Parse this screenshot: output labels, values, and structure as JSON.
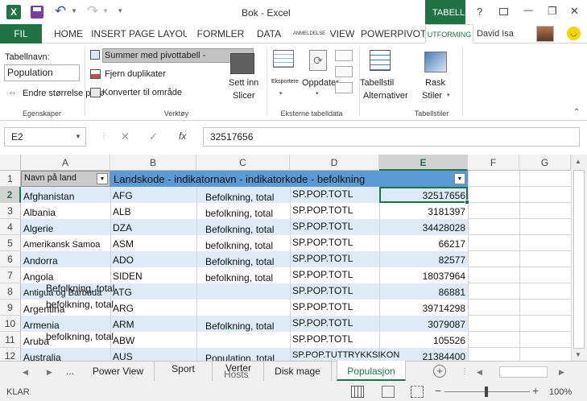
{
  "window": {
    "title": "Bok - Excel",
    "context_tab": "TABELL..."
  },
  "quick_access": {
    "save": "save-icon",
    "undo": "undo-icon",
    "redo": "redo-icon"
  },
  "title_controls": {
    "help": "?",
    "minimize": "—",
    "restore": "❐",
    "close": "✕"
  },
  "ribbon_tabs": [
    "FIL",
    "HOME",
    "INSERT",
    "PAGE LAYOU",
    "FORMLER",
    "DATA",
    "ANMELDELSE",
    "VIEW",
    "POWERPIVOT",
    "UTFORMING"
  ],
  "user": {
    "name": "David Isa"
  },
  "ribbon": {
    "egenskaper": {
      "label": "Tabellnavn:",
      "value": "Population",
      "resize": "Endre størrelse på ta",
      "group": "Egenskaper"
    },
    "verktoy": {
      "pivot": "Summer med pivottabell -",
      "remove_dup": "Fjern duplikater",
      "convert": "Konverter til område",
      "slicer_line1": "Sett inn",
      "slicer_line2": "Slicer",
      "group": "Verktøy"
    },
    "eksterne": {
      "export": "Eksportere",
      "refresh": "Oppdater",
      "group": "Eksterne tabelldata"
    },
    "tabellstil": {
      "options_line1": "Tabellstil",
      "options_line2": "Alternativer",
      "quick_line1": "Rask",
      "quick_line2": "Stiler",
      "group": "Tabellstiler"
    }
  },
  "formula_bar": {
    "name_box": "E2",
    "fx": "fx",
    "value": "32517656"
  },
  "columns": [
    "A",
    "B",
    "C",
    "D",
    "E",
    "F",
    "G"
  ],
  "rows": [
    "1",
    "2",
    "3",
    "4",
    "5",
    "6",
    "7",
    "8",
    "9",
    "10",
    "11",
    "12"
  ],
  "header_row": {
    "a": "Navn på land",
    "merged": "Landskode - indikatornavn - indikatorkode - befolkning"
  },
  "data": [
    {
      "a": "Afghanistan",
      "b": "AFG",
      "c": "Befolkning, total",
      "d": "SP.POP.TOTL",
      "e": "32517656"
    },
    {
      "a": "Albania",
      "b": "ALB",
      "c": "befolkning, total",
      "d": "SP.POP.TOTL",
      "e": "3181397"
    },
    {
      "a": "Algerie",
      "b": "DZA",
      "c": "Befolkning, total",
      "d": "SP.POP.TOTL",
      "e": "34428028"
    },
    {
      "a": "Amerikansk Samoa",
      "b": "ASM",
      "c": "befolkning, total",
      "d": "SP.POP.TOTL",
      "e": "66217"
    },
    {
      "a": "Andorra",
      "b": "ADO",
      "c": "Befolkning, total",
      "d": "SP.POP.TOTL",
      "e": "82577"
    },
    {
      "a": "Angola",
      "b": "SIDEN",
      "c": "befolkning, total",
      "d": "SP.POP.TOTL",
      "e": "18037964"
    },
    {
      "a": "Antigua og Barbuda",
      "a2": "Befolkning, total",
      "b": "ATG",
      "c": "",
      "d": "SP.POP.TOTL",
      "e": "86881"
    },
    {
      "a": "Argentina",
      "a2": "befolkning, total",
      "b": "ARG",
      "c": "",
      "d": "SP.POP.TOTL",
      "e": "39714298"
    },
    {
      "a": "Armenia",
      "b": "ARM",
      "c": "Befolkning, total",
      "d": "SP.POP.TOTL",
      "e": "3079087"
    },
    {
      "a": "Aruba",
      "a2": "befolkning, total",
      "b": "ABW",
      "c": "",
      "d": "SP.POP.TOTL",
      "e": "105526"
    },
    {
      "a": "Australia",
      "b": "AUS",
      "c": "Population, total",
      "d": "SP.POP.TUTTRYKKSIKON",
      "e": "21384400"
    }
  ],
  "sheet_tabs": [
    "Power View",
    "Sport",
    "Verter",
    "Disk mage",
    "Populasjon"
  ],
  "sheet_tab_overlay": "Hosts",
  "ellipsis": "...",
  "status": {
    "ready": "KLAR",
    "zoom": "100%"
  },
  "colors": {
    "accent": "#217346",
    "table_header": "#5b9bd5",
    "band": "#ddebf7"
  }
}
